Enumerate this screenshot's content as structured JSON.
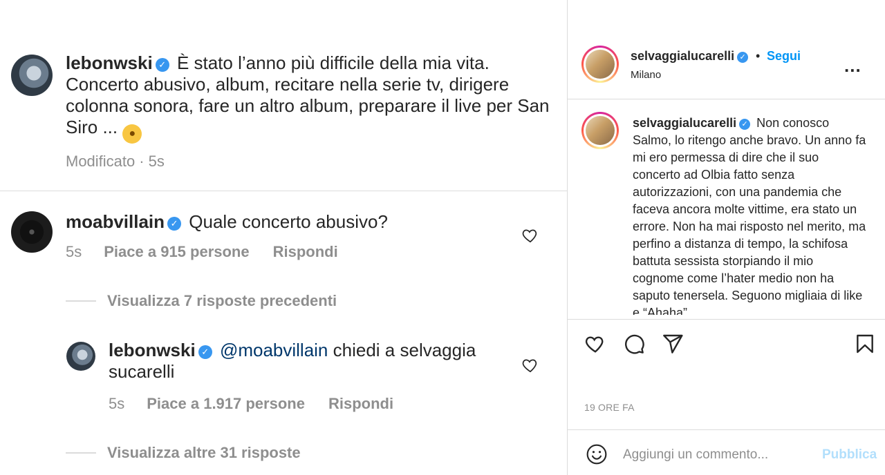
{
  "post": {
    "author": "lebonwski",
    "caption": "È stato l’anno più difficile della mia vita. Concerto abusivo, album, recitare nella serie tv, dirigere colonna sonora, fare un altro album, preparare il live per San Siro ...",
    "edited_label": "Modificato",
    "dot": "·",
    "time": "5s"
  },
  "comments": [
    {
      "author": "moabvillain",
      "text": "Quale concerto abusivo?",
      "time": "5s",
      "likes": "Piace a 915 persone",
      "reply": "Rispondi",
      "view_replies": "Visualizza 7 risposte precedenti"
    },
    {
      "author": "lebonwski",
      "mention": "@moabvillain",
      "text": "chiedi a selvaggia sucarelli",
      "time": "5s",
      "likes": "Piace a 1.917 persone",
      "reply": "Rispondi",
      "view_replies": "Visualizza altre 31 risposte"
    }
  ],
  "right": {
    "username": "selvaggialucarelli",
    "dot": "•",
    "follow": "Segui",
    "location": "Milano",
    "more": "...",
    "caption_author": "selvaggialucarelli",
    "caption": "Non conosco Salmo, lo ritengo anche bravo. Un anno fa mi ero permessa di dire che il suo concerto ad Olbia fatto senza autorizzazioni, con una pandemia che faceva ancora molte vittime, era stato un errore. Non ha mai risposto nel merito, ma perfino a distanza di tempo, la schifosa battuta sessista storpiando il mio cognome come l’hater medio non ha saputo tenersela. Seguono migliaia di like e “Ahaha”",
    "time": "19 ORE FA",
    "add_comment_placeholder": "Aggiungi un commento...",
    "publish": "Pubblica"
  },
  "icons": {
    "verified": "✓",
    "emoji": "🤯"
  },
  "colors": {
    "link_blue": "#0095f6",
    "verified_blue": "#3897f0",
    "muted": "#8e8e8e",
    "publish_disabled": "#b2dffc",
    "mention": "#00376b"
  }
}
